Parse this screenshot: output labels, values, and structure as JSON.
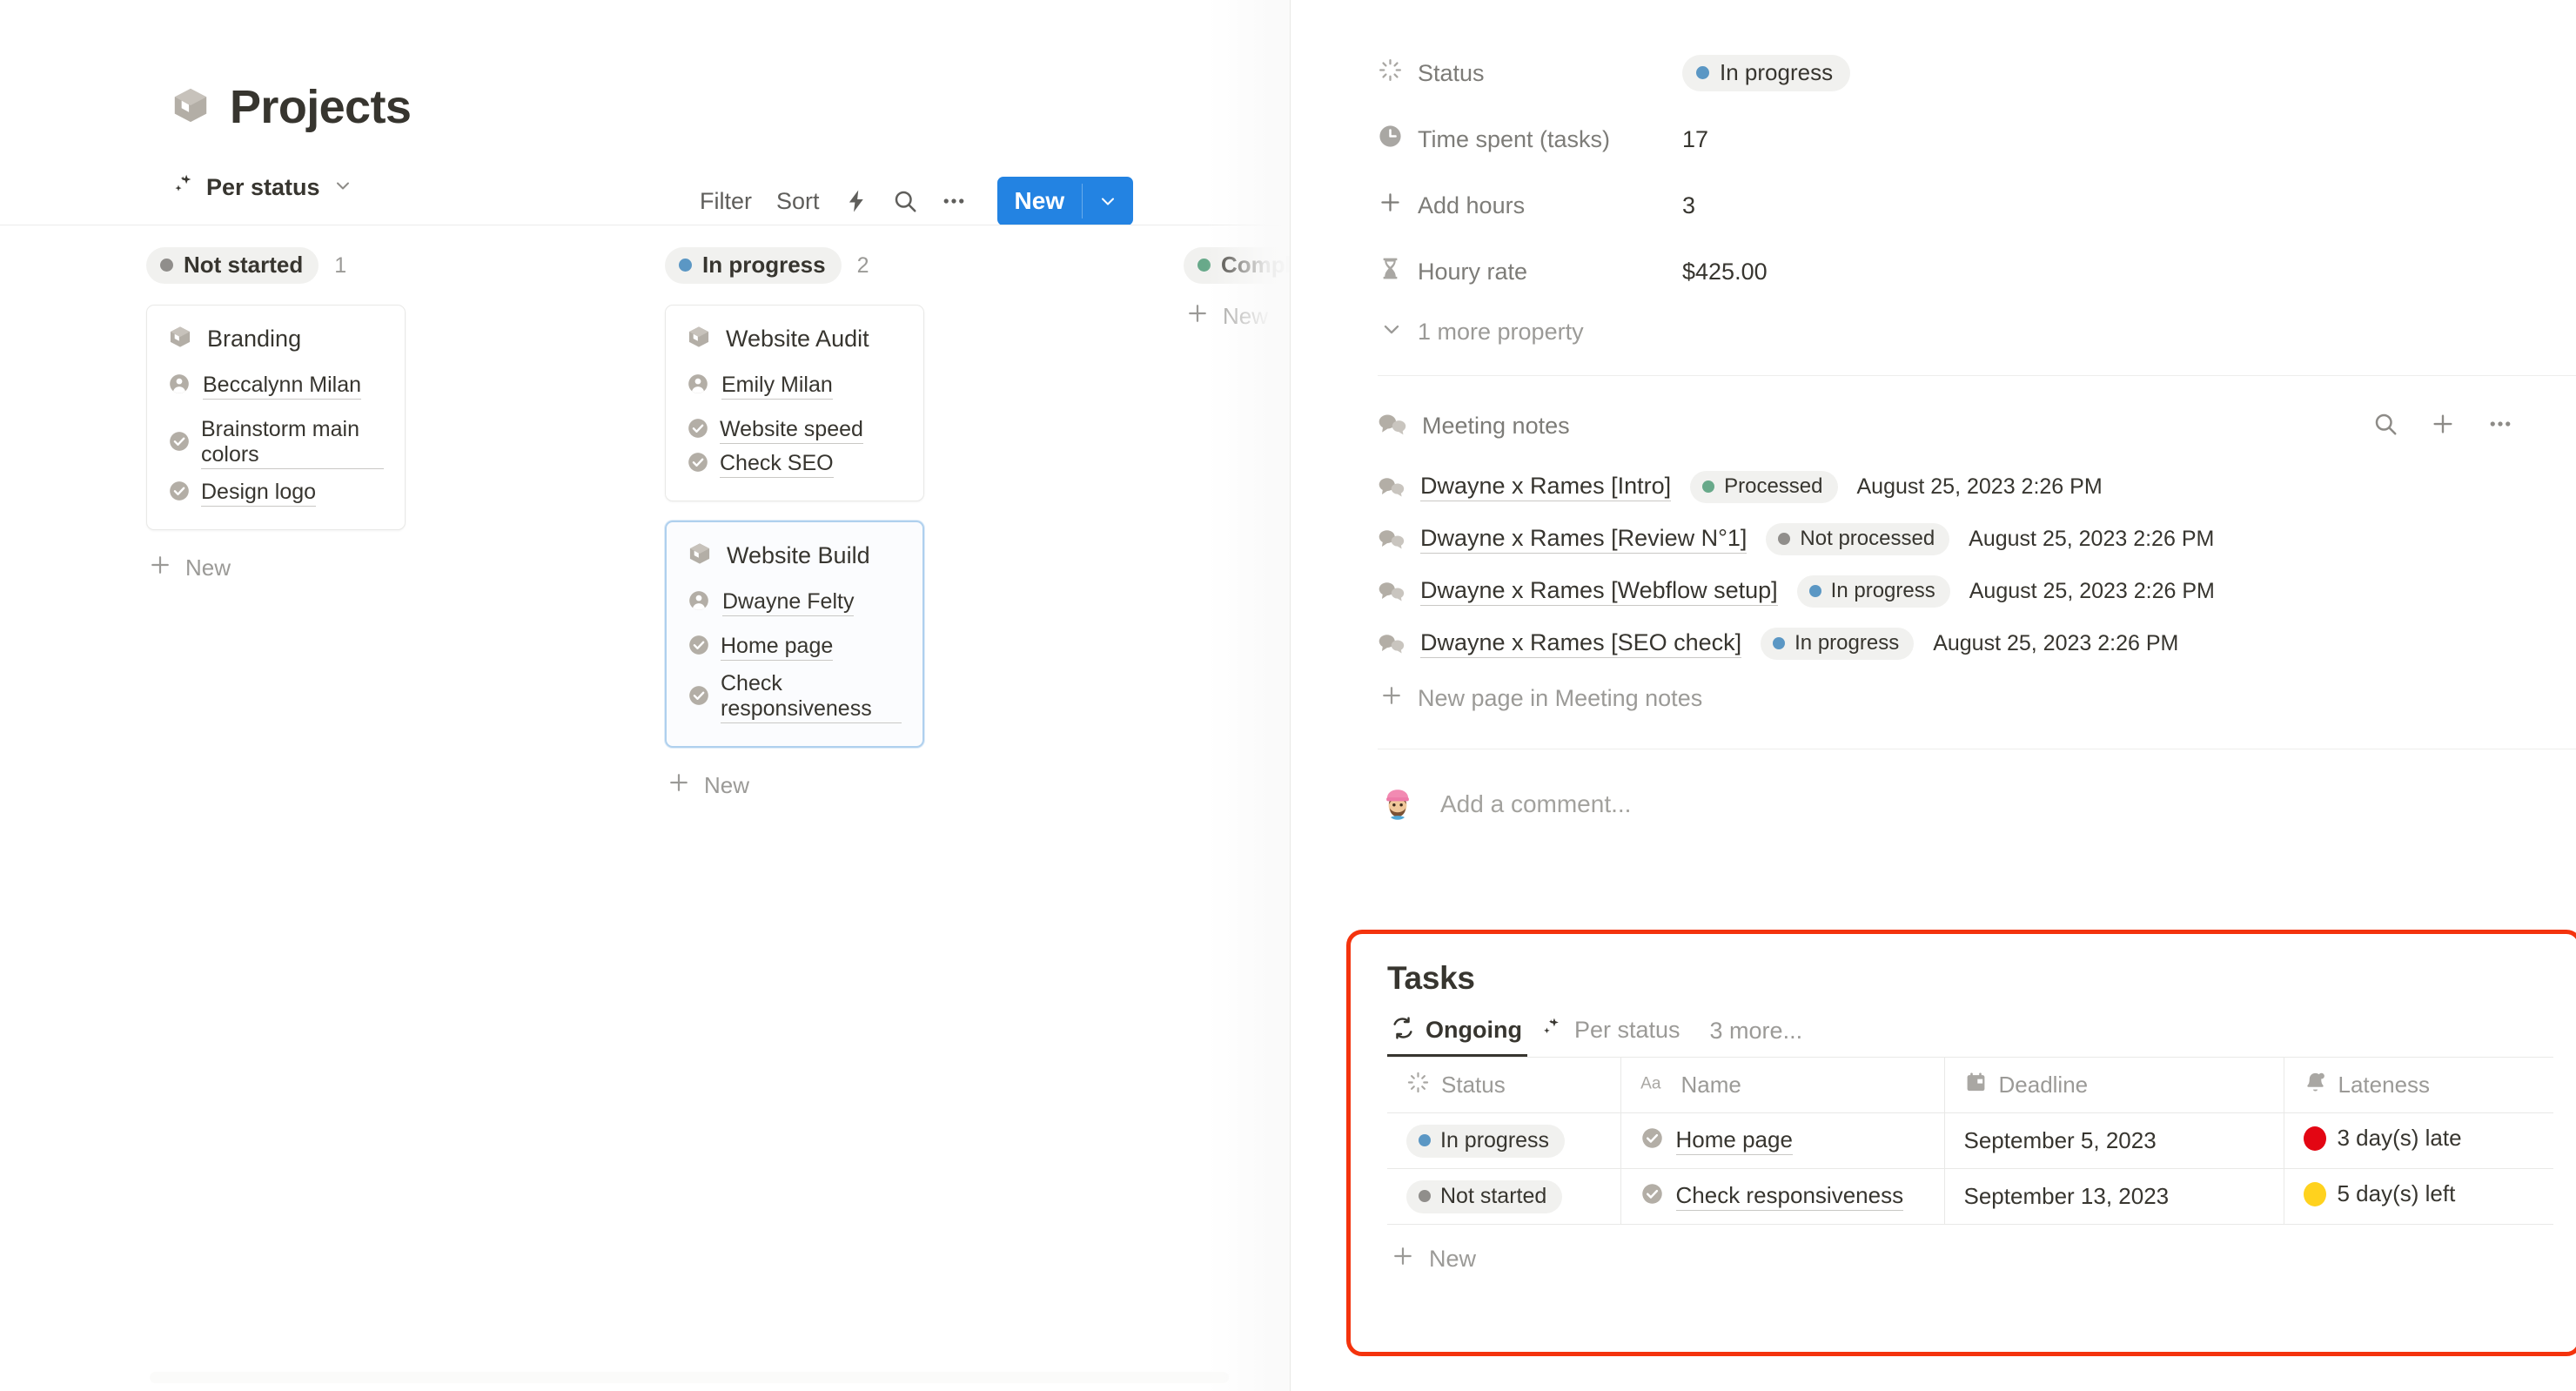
{
  "colors": {
    "accent_blue": "#2383e2",
    "status_blue": "#5b97c4",
    "status_gray": "#908e8b",
    "status_green": "#68a98a",
    "annotation_red": "#f4330d",
    "late_red": "#e30613",
    "late_yellow": "#ffd21e",
    "text": "#37352f",
    "muted": "#9b9a97"
  },
  "left": {
    "page_title": "Projects",
    "page_icon": "package-box-icon",
    "view": {
      "label": "Per status",
      "icon": "sparkle-icon",
      "chevron": "chevron-down-icon"
    },
    "toolbar": {
      "filter": "Filter",
      "sort": "Sort",
      "automation_icon": "lightning-bolt-icon",
      "search_icon": "search-icon",
      "more_icon": "ellipsis-icon",
      "new_label": "New",
      "new_chevron": "chevron-down-icon"
    },
    "columns": [
      {
        "status": "Not started",
        "dot_color": "#908e8b",
        "count": "1",
        "add_label": "New",
        "cards": [
          {
            "title": "Branding",
            "icon": "package-box-icon",
            "person": "Beccalynn Milan",
            "selected": false,
            "tasks": [
              "Brainstorm main colors",
              "Design logo"
            ],
            "tasks_wrap": true
          }
        ]
      },
      {
        "status": "In progress",
        "dot_color": "#5b97c4",
        "count": "2",
        "add_label": "New",
        "cards": [
          {
            "title": "Website Audit",
            "icon": "package-box-icon",
            "person": "Emily Milan",
            "selected": false,
            "tasks": [
              "Website speed",
              "Check SEO"
            ],
            "tasks_wrap": false
          },
          {
            "title": "Website Build",
            "icon": "package-box-icon",
            "person": "Dwayne Felty",
            "selected": true,
            "tasks": [
              "Home page",
              "Check responsiveness"
            ],
            "tasks_wrap": true
          }
        ]
      },
      {
        "status": "Completed",
        "dot_color": "#68a98a",
        "count": "",
        "add_label": "New",
        "cards": []
      }
    ]
  },
  "right": {
    "properties": [
      {
        "label": "Status",
        "icon": "status-spinner-icon",
        "value": "In progress",
        "type": "chip",
        "dot_color": "#5b97c4"
      },
      {
        "label": "Time spent (tasks)",
        "icon": "clock-icon",
        "value": "17",
        "type": "text"
      },
      {
        "label": "Add hours",
        "icon": "plus-icon",
        "value": "3",
        "type": "text"
      },
      {
        "label": "Houry rate",
        "icon": "hourglass-icon",
        "value": "$425.00",
        "type": "text"
      }
    ],
    "more_properties": "1 more property",
    "more_properties_icon": "chevron-down-icon",
    "meeting_notes": {
      "title": "Meeting notes",
      "title_icon": "speech-bubbles-icon",
      "actions": [
        "search-icon",
        "plus-icon",
        "ellipsis-icon"
      ],
      "rows": [
        {
          "name": "Dwayne x Rames [Intro]",
          "status": "Processed",
          "dot_color": "#68a98a",
          "date": "August 25, 2023 2:26 PM"
        },
        {
          "name": "Dwayne x Rames [Review N°1]",
          "status": "Not processed",
          "dot_color": "#908e8b",
          "date": "August 25, 2023 2:26 PM"
        },
        {
          "name": "Dwayne x Rames [Webflow setup]",
          "status": "In progress",
          "dot_color": "#5b97c4",
          "date": "August 25, 2023 2:26 PM"
        },
        {
          "name": "Dwayne x Rames [SEO check]",
          "status": "In progress",
          "dot_color": "#5b97c4",
          "date": "August 25, 2023 2:26 PM"
        }
      ],
      "new_page_label": "New page in Meeting notes",
      "new_page_icon": "plus-icon"
    },
    "comment": {
      "placeholder": "Add a comment...",
      "avatar": "user-avatar-beanie"
    },
    "tasks": {
      "title": "Tasks",
      "tabs": [
        {
          "label": "Ongoing",
          "icon": "sync-cycle-icon",
          "active": true
        },
        {
          "label": "Per status",
          "icon": "sparkle-icon",
          "active": false
        }
      ],
      "more_tabs": "3 more...",
      "columns": [
        {
          "label": "Status",
          "icon": "status-spinner-icon"
        },
        {
          "label": "Name",
          "icon": "title-aa-icon"
        },
        {
          "label": "Deadline",
          "icon": "calendar-icon"
        },
        {
          "label": "Lateness",
          "icon": "bell-icon"
        }
      ],
      "rows": [
        {
          "status": "In progress",
          "status_dot": "#5b97c4",
          "name": "Home page",
          "name_icon": "check-circle-icon",
          "deadline": "September 5, 2023",
          "lateness": "3 day(s) late",
          "lateness_dot": "#e30613"
        },
        {
          "status": "Not started",
          "status_dot": "#908e8b",
          "name": "Check responsiveness",
          "name_icon": "check-circle-icon",
          "deadline": "September 13, 2023",
          "lateness": "5 day(s) left",
          "lateness_dot": "#ffd21e"
        }
      ],
      "new_label": "New",
      "new_icon": "plus-icon"
    }
  }
}
